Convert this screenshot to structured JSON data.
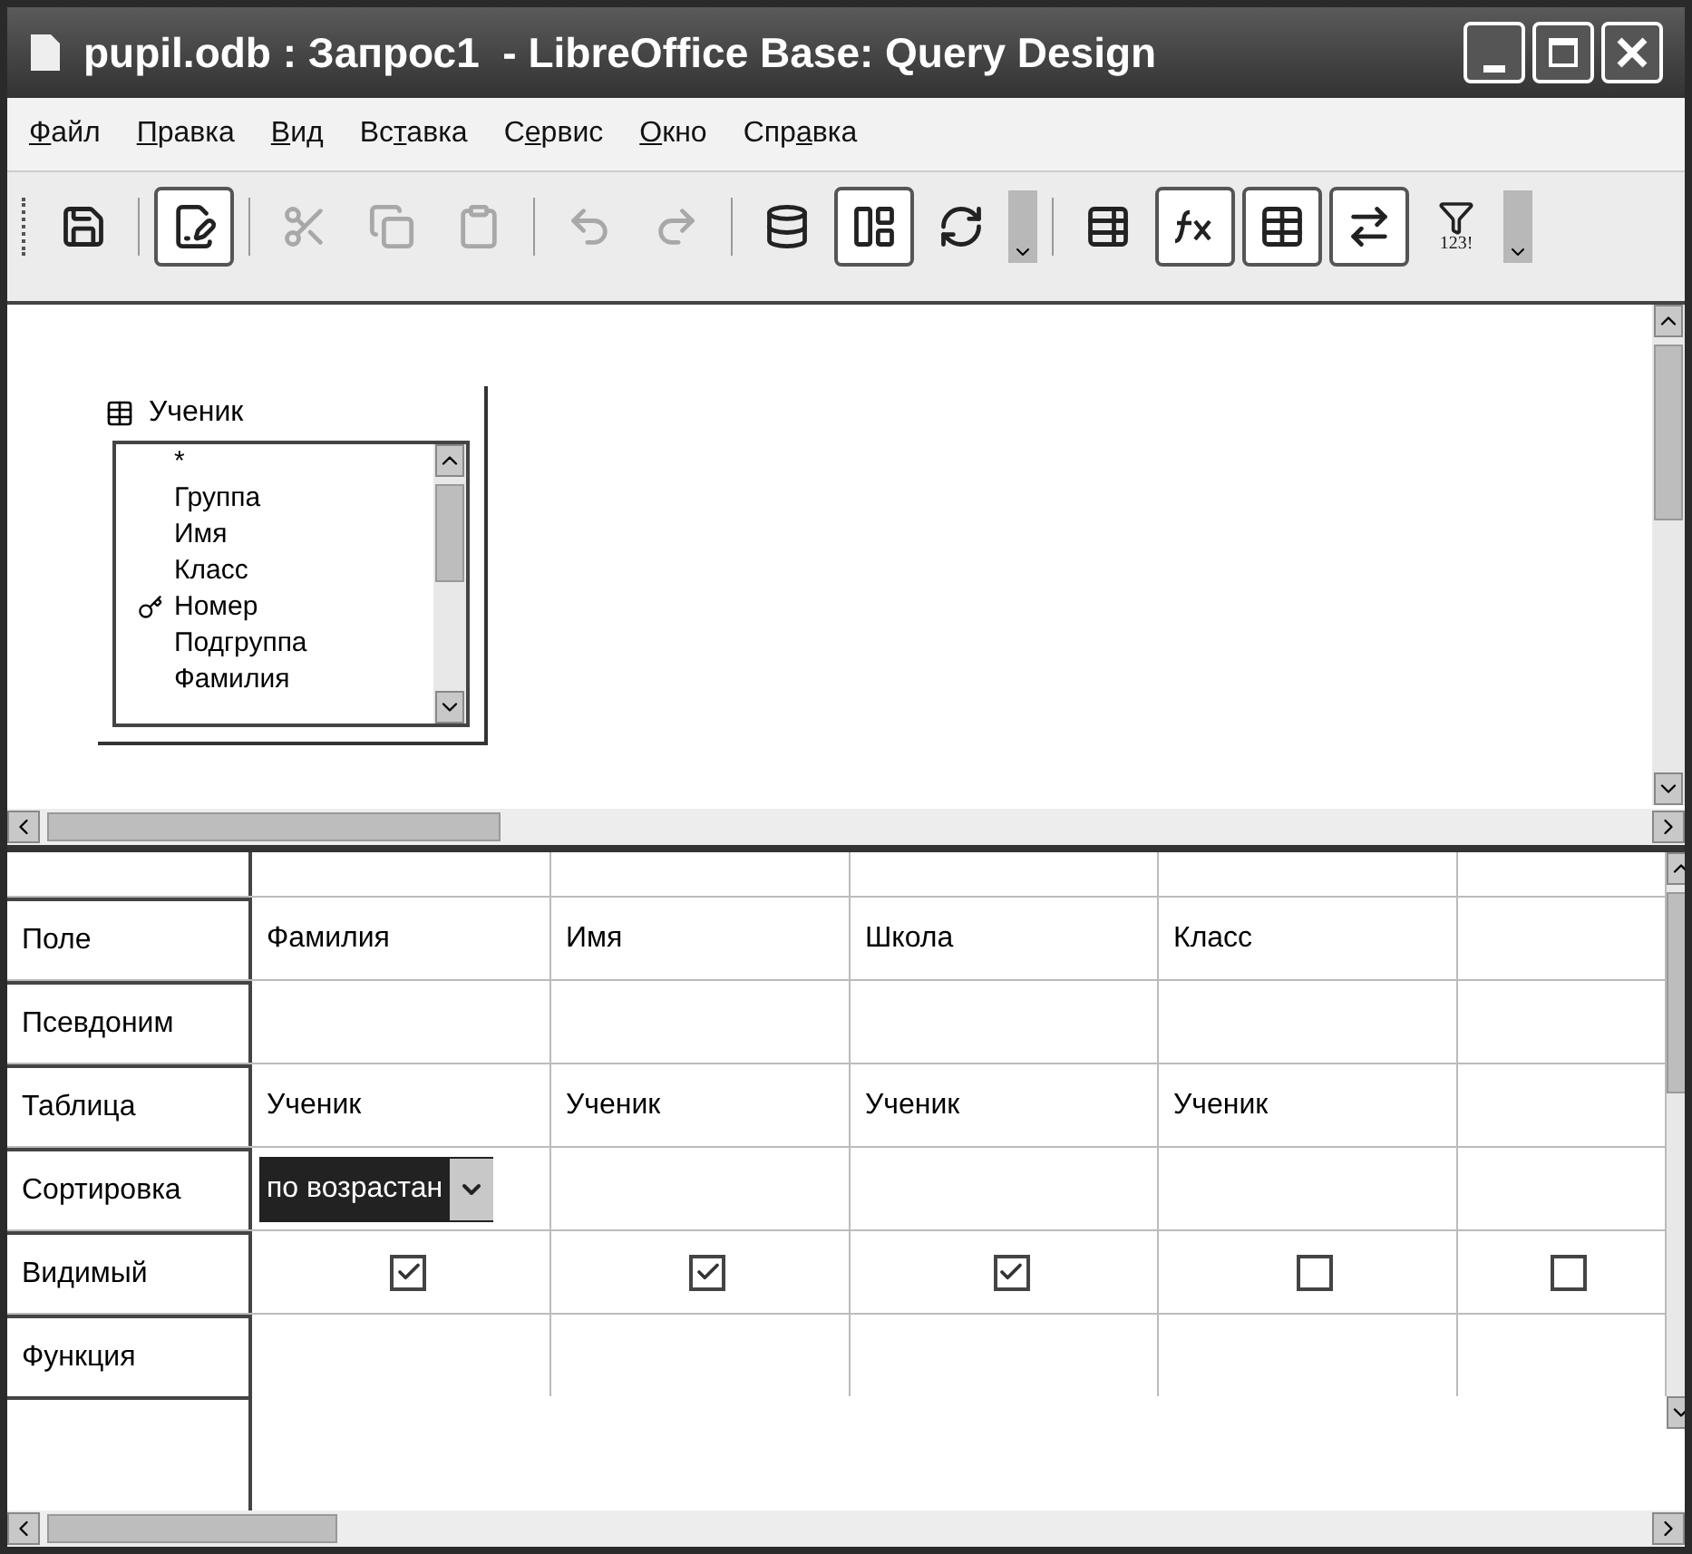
{
  "window": {
    "title": "pupil.odb : Запрос1  - LibreOffice Base: Query Design"
  },
  "menu": [
    {
      "key": "Ф",
      "post": "айл"
    },
    {
      "key": "П",
      "post": "равка"
    },
    {
      "key": "В",
      "post": "ид"
    },
    {
      "pre": "Вс",
      "key": "т",
      "post": "авка"
    },
    {
      "pre": "С",
      "key": "е",
      "post": "рвис"
    },
    {
      "key": "О",
      "post": "кно"
    },
    {
      "pre": "Спр",
      "key": "а",
      "post": "вка"
    }
  ],
  "toolbar": [
    {
      "kind": "save",
      "pressed": false,
      "disabled": false
    },
    {
      "kind": "sep"
    },
    {
      "kind": "edit",
      "pressed": true,
      "disabled": false
    },
    {
      "kind": "sep"
    },
    {
      "kind": "cut",
      "pressed": false,
      "disabled": true
    },
    {
      "kind": "copy",
      "pressed": false,
      "disabled": true
    },
    {
      "kind": "paste",
      "pressed": false,
      "disabled": true
    },
    {
      "kind": "sep"
    },
    {
      "kind": "undo",
      "pressed": false,
      "disabled": true
    },
    {
      "kind": "redo",
      "pressed": false,
      "disabled": true
    },
    {
      "kind": "sep"
    },
    {
      "kind": "run",
      "pressed": false,
      "disabled": false
    },
    {
      "kind": "design",
      "pressed": true,
      "disabled": false
    },
    {
      "kind": "refresh",
      "pressed": false,
      "disabled": false
    },
    {
      "kind": "more"
    },
    {
      "kind": "sep"
    },
    {
      "kind": "addtable",
      "pressed": false,
      "disabled": false
    },
    {
      "kind": "function",
      "pressed": true,
      "disabled": false
    },
    {
      "kind": "tablename",
      "pressed": true,
      "disabled": false
    },
    {
      "kind": "alias",
      "pressed": true,
      "disabled": false
    },
    {
      "kind": "filter",
      "pressed": false,
      "disabled": false,
      "label": "123!"
    },
    {
      "kind": "more"
    }
  ],
  "table_window": {
    "title": "Ученик",
    "fields": [
      {
        "name": "*",
        "primary_key": false
      },
      {
        "name": "Группа",
        "primary_key": false
      },
      {
        "name": "Имя",
        "primary_key": false
      },
      {
        "name": "Класс",
        "primary_key": false
      },
      {
        "name": "Номер",
        "primary_key": true
      },
      {
        "name": "Подгруппа",
        "primary_key": false
      },
      {
        "name": "Фамилия",
        "primary_key": false
      }
    ]
  },
  "grid": {
    "row_labels": [
      "Поле",
      "Псевдоним",
      "Таблица",
      "Сортировка",
      "Видимый",
      "Функция"
    ],
    "columns": [
      {
        "field": "Фамилия",
        "table": "Ученик",
        "sort": "по возрастан",
        "visible": true
      },
      {
        "field": "Имя",
        "table": "Ученик",
        "visible": true
      },
      {
        "field": "Школа",
        "table": "Ученик",
        "visible": true
      },
      {
        "field": "Класс",
        "table": "Ученик",
        "visible": false
      },
      {
        "visible": false
      }
    ]
  }
}
